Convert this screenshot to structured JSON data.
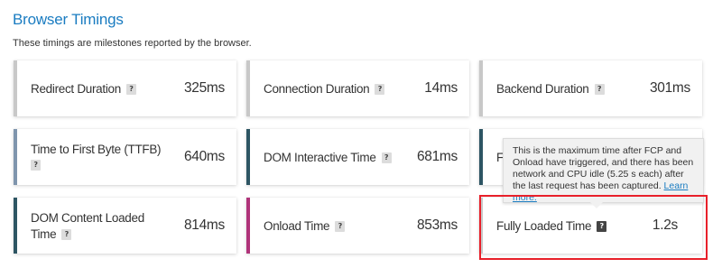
{
  "section": {
    "title": "Browser Timings",
    "subtitle": "These timings are milestones reported by the browser."
  },
  "help_glyph": "?",
  "cards": {
    "redirect": {
      "label": "Redirect Duration",
      "value": "325ms"
    },
    "connection": {
      "label": "Connection Duration",
      "value": "14ms"
    },
    "backend": {
      "label": "Backend Duration",
      "value": "301ms"
    },
    "ttfb": {
      "label": "Time to First Byte (TTFB)",
      "value": "640ms"
    },
    "dom_interactive": {
      "label": "DOM Interactive Time",
      "value": "681ms"
    },
    "first_paint": {
      "label": "F"
    },
    "dom_content_loaded": {
      "label_line1": "DOM Content Loaded",
      "label_line2": "Time",
      "value": "814ms"
    },
    "onload": {
      "label": "Onload Time",
      "value": "853ms"
    },
    "fully_loaded": {
      "label": "Fully Loaded Time",
      "value": "1.2s"
    }
  },
  "tooltip": {
    "text": "This is the maximum time after FCP and Onload have triggered, and there has been network and CPU idle (5.25 s each) after the last request has been captured.",
    "link": "Learn more."
  },
  "colors": {
    "title": "#1a7cc1",
    "accent_gray": "#c8c8c8",
    "accent_steel": "#7f95ad",
    "accent_slate": "#2d5563",
    "accent_magenta": "#b0347a",
    "highlight_red": "#e8202a"
  }
}
